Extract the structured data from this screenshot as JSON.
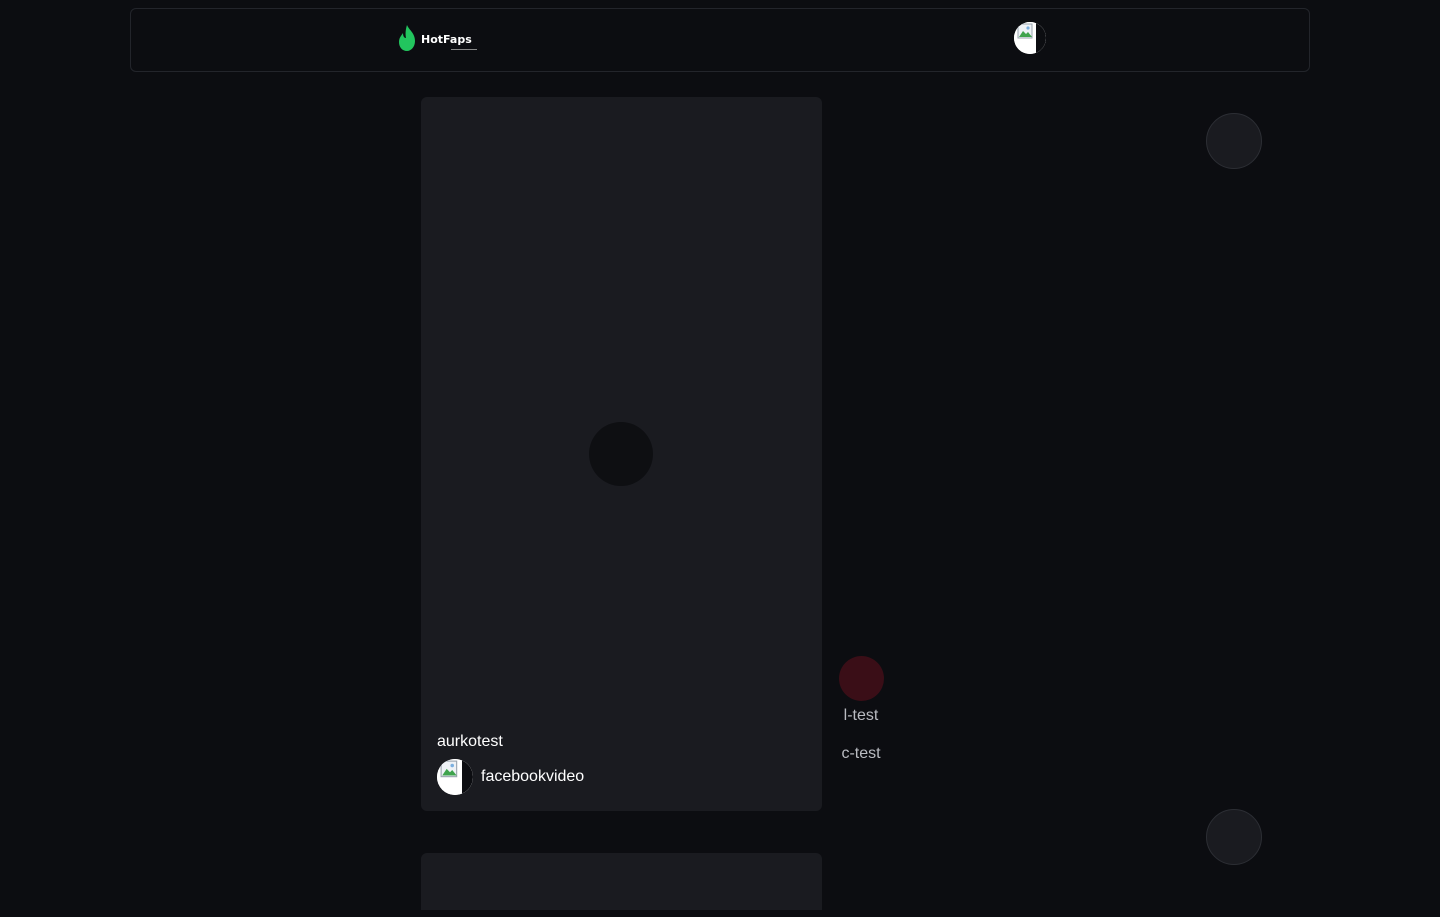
{
  "header": {
    "logo_text": "HotFaps",
    "logo_color": "#22c55e"
  },
  "post": {
    "title": "aurkotest",
    "author": "facebookvideo",
    "actions": [
      {
        "label": "l-test"
      },
      {
        "label": "c-test"
      }
    ]
  },
  "icons": {
    "play": "play-icon",
    "like": "heart-icon",
    "nav_up": "chevron-up-icon",
    "nav_down": "chevron-down-icon"
  }
}
